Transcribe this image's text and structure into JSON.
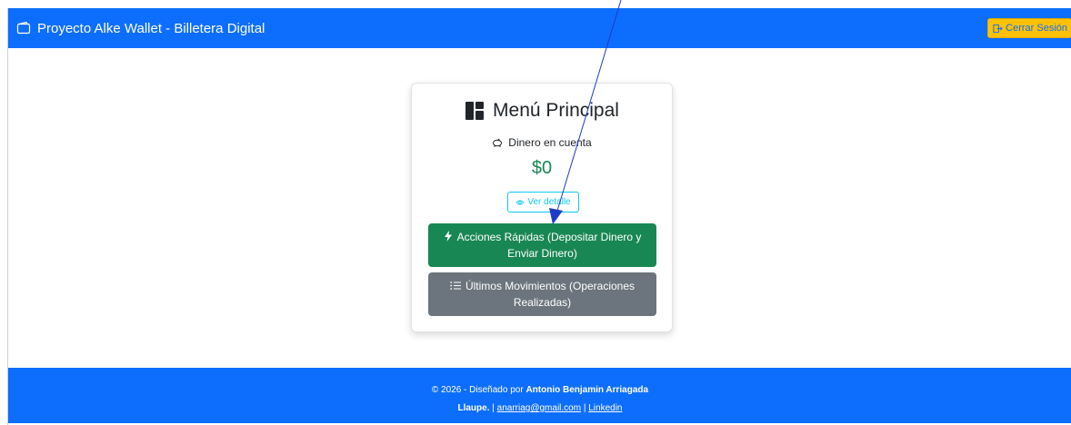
{
  "navbar": {
    "brand_title": "Proyecto Alke Wallet - Billetera Digital",
    "logout_label": "Cerrar Sesión",
    "colors": {
      "primary": "#0d6efd",
      "logout_bg": "#ffc107"
    }
  },
  "card": {
    "title": "Menú Principal",
    "balance_label": "Dinero en cuenta",
    "balance_amount": "$0",
    "detail_button": "Ver detalle",
    "quick_actions_button": "Acciones Rápidas (Depositar Dinero y Enviar Dinero)",
    "movements_button": "Últimos Movimientos (Operaciones Realizadas)",
    "icons": [
      "dashboard-icon",
      "piggy-bank-icon",
      "eye-icon",
      "lightning-icon",
      "list-icon"
    ]
  },
  "footer": {
    "prefix": "© 2026 - Diseñado por ",
    "author_part1": "Antonio Benjamin Arriagada",
    "author_part2": "Llaupe.",
    "separator1": " | ",
    "email": "anarriag@gmail.com",
    "separator2": " | ",
    "linkedin": "Linkedin"
  }
}
